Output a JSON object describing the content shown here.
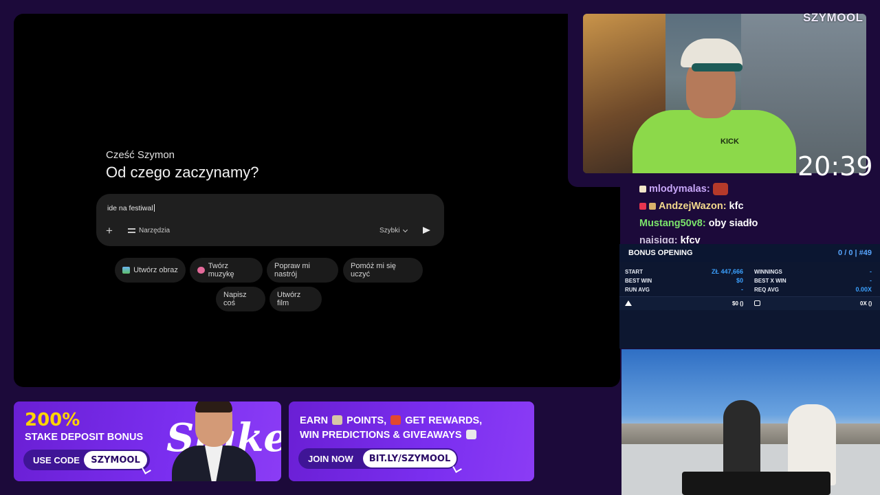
{
  "screen": {
    "greeting": "Cześć Szymon",
    "headline": "Od czego zaczynamy?",
    "prompt_value": "ide na festiwal",
    "tools_label": "Narzędzia",
    "speed_label": "Szybki",
    "chips": [
      "Utwórz obraz",
      "Twórz muzykę",
      "Popraw mi nastrój",
      "Pomóż mi się uczyć",
      "Napisz coś",
      "Utwórz film"
    ]
  },
  "stream": {
    "brand": "SZYMOOL",
    "clock": "20:39",
    "cam_shirt_text": "KICK"
  },
  "chat": [
    {
      "user": "mlodymalas:",
      "message": "",
      "color": "#c7a6f7"
    },
    {
      "user": "AndzejWazon:",
      "message": "kfc",
      "color": "#f3d98c"
    },
    {
      "user": "Mustang50v8:",
      "message": "oby siadło",
      "color": "#7be36b"
    },
    {
      "user": "naisiqq:",
      "message": "kfcv",
      "color": "#c9c1d9"
    }
  ],
  "bonus": {
    "title": "BONUS OPENING",
    "count": "0 / 0 | #49",
    "start_label": "START",
    "start_value": "ZŁ 447,666",
    "best_win_label": "BEST WIN",
    "best_win_value": "$0",
    "run_avg_label": "RUN AVG",
    "run_avg_value": "-",
    "winnings_label": "WINNINGS",
    "winnings_value": "-",
    "best_x_win_label": "BEST X WIN",
    "best_x_win_value": "-",
    "req_avg_label": "REQ AVG",
    "req_avg_value": "0.00X",
    "foot_left": "$0 ()",
    "foot_right": "0X ()"
  },
  "promo1": {
    "percent": "200%",
    "line": "STAKE DEPOSIT BONUS",
    "use_code": "USE CODE",
    "code": "SZYMOOL",
    "logo": "Stake"
  },
  "promo2": {
    "line1_a": "EARN",
    "line1_b": "POINTS,",
    "line1_c": "GET REWARDS,",
    "line2": "WIN PREDICTIONS & GIVEAWAYS",
    "join": "JOIN NOW",
    "link": "BIT.LY/SZYMOOL"
  },
  "colors": {
    "background": "#1c0a3a",
    "promo": "#7b2ff0",
    "accent_yellow": "#ffd400",
    "bonus_blue": "#3ba1ff"
  },
  "icons": [
    "plus-icon",
    "tools-icon",
    "chevron-down-icon",
    "send-icon",
    "crown-icon",
    "scale-icon"
  ]
}
